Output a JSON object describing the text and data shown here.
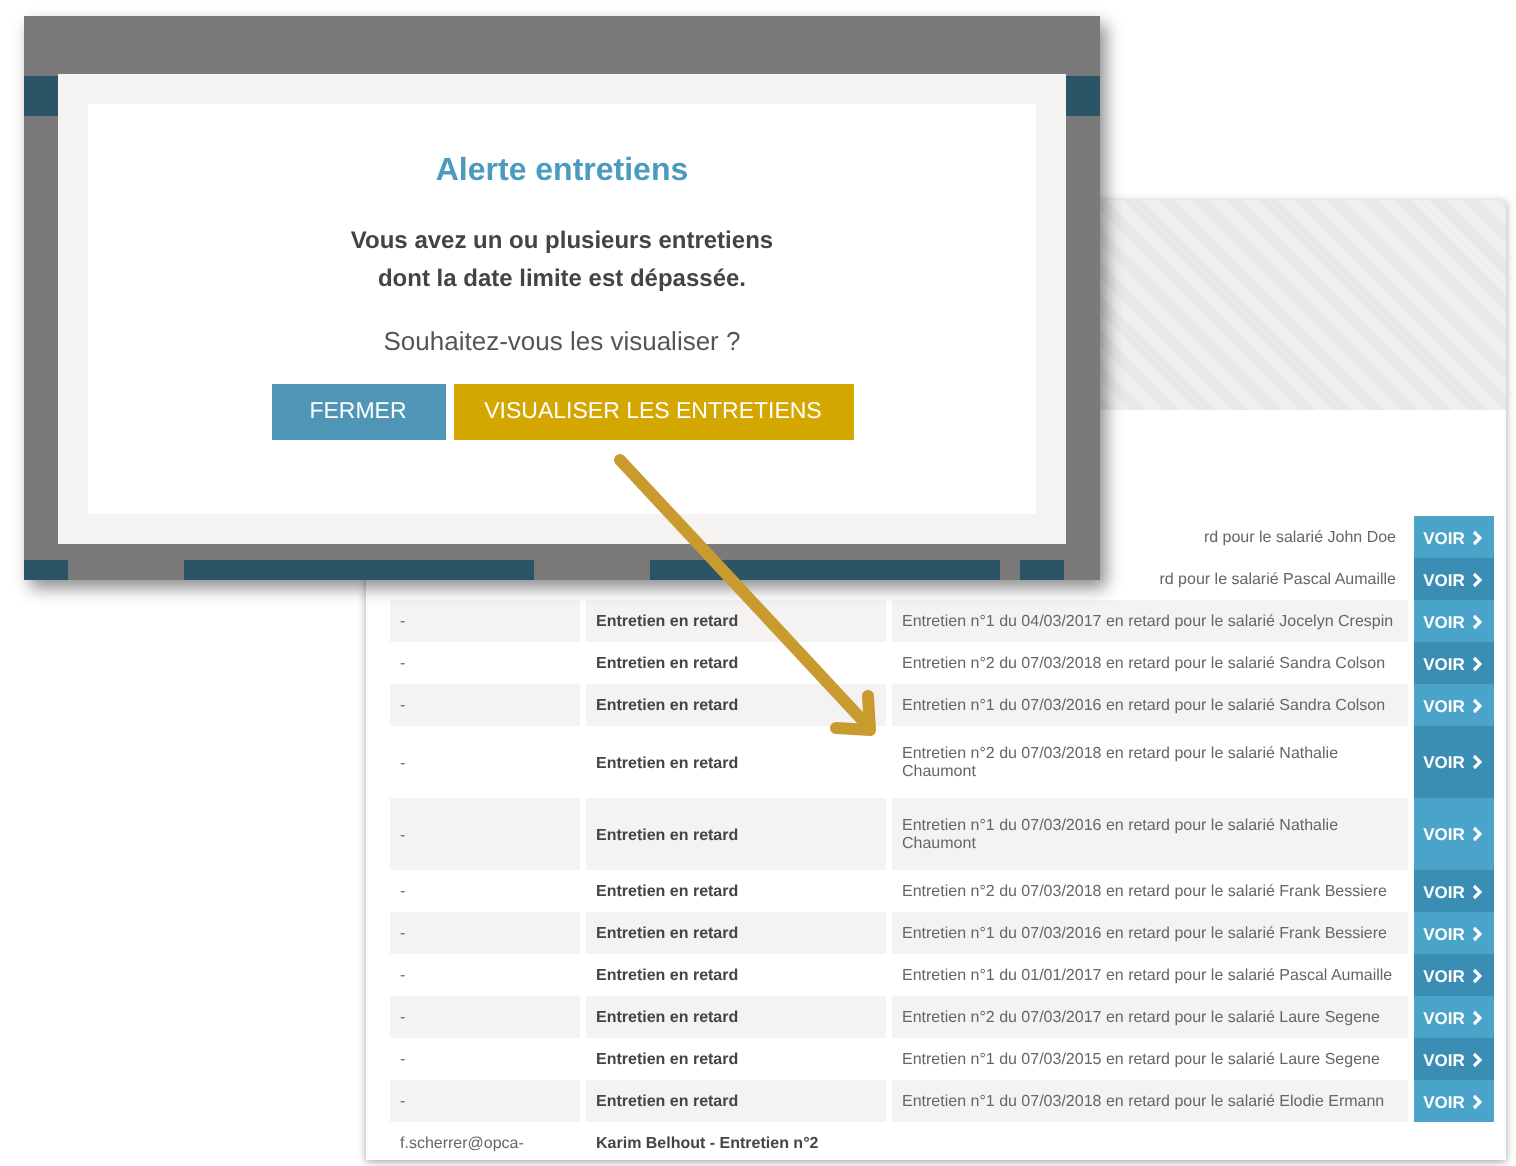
{
  "dialog": {
    "title": "Alerte entretiens",
    "message": "Vous avez un ou plusieurs entretiens\ndont la date limite est dépassée.",
    "question": "Souhaitez-vous les visualiser ?",
    "buttons": [
      {
        "label": "FERMER",
        "kind": "secondary"
      },
      {
        "label": "VISUALISER LES ENTRETIENS",
        "kind": "primary"
      }
    ]
  },
  "table": {
    "rows": [
      {
        "column_3": "rd pour le salarié John Doe",
        "action": "VOIR"
      },
      {
        "column_3": "rd pour le salarié Pascal Aumaille",
        "action": "VOIR"
      },
      {
        "column_1": "-",
        "column_2": "Entretien en retard",
        "column_3": "Entretien n°1 du 04/03/2017 en retard pour le salarié Jocelyn Crespin",
        "action": "VOIR"
      },
      {
        "column_1": "-",
        "column_2": "Entretien en retard",
        "column_3": "Entretien n°2 du 07/03/2018 en retard pour le salarié Sandra Colson",
        "action": "VOIR"
      },
      {
        "column_1": "-",
        "column_2": "Entretien en retard",
        "column_3": "Entretien n°1 du 07/03/2016 en retard pour le salarié Sandra Colson",
        "action": "VOIR"
      },
      {
        "column_1": "-",
        "column_2": "Entretien en retard",
        "column_3": "Entretien n°2 du 07/03/2018 en retard pour le salarié Nathalie Chaumont",
        "action": "VOIR"
      },
      {
        "column_1": "-",
        "column_2": "Entretien en retard",
        "column_3": "Entretien n°1 du 07/03/2016 en retard pour le salarié Nathalie Chaumont",
        "action": "VOIR"
      },
      {
        "column_1": "-",
        "column_2": "Entretien en retard",
        "column_3": "Entretien n°2 du 07/03/2018 en retard pour le salarié Frank Bessiere",
        "action": "VOIR"
      },
      {
        "column_1": "-",
        "column_2": "Entretien en retard",
        "column_3": "Entretien n°1 du 07/03/2016 en retard pour le salarié Frank Bessiere",
        "action": "VOIR"
      },
      {
        "column_1": "-",
        "column_2": "Entretien en retard",
        "column_3": "Entretien n°1 du 01/01/2017 en retard pour le salarié Pascal Aumaille",
        "action": "VOIR"
      },
      {
        "column_1": "-",
        "column_2": "Entretien en retard",
        "column_3": "Entretien n°2 du 07/03/2017 en retard pour le salarié Laure Segene",
        "action": "VOIR"
      },
      {
        "column_1": "-",
        "column_2": "Entretien en retard",
        "column_3": "Entretien n°1 du 07/03/2015 en retard pour le salarié Laure Segene",
        "action": "VOIR"
      },
      {
        "column_1": "-",
        "column_2": "Entretien en retard",
        "column_3": "Entretien n°1 du 07/03/2018 en retard pour le salarié Elodie Ermann",
        "action": "VOIR"
      },
      {
        "column_1": "f.scherrer@opca-",
        "column_2": "Karim Belhout - Entretien n°2"
      }
    ]
  }
}
